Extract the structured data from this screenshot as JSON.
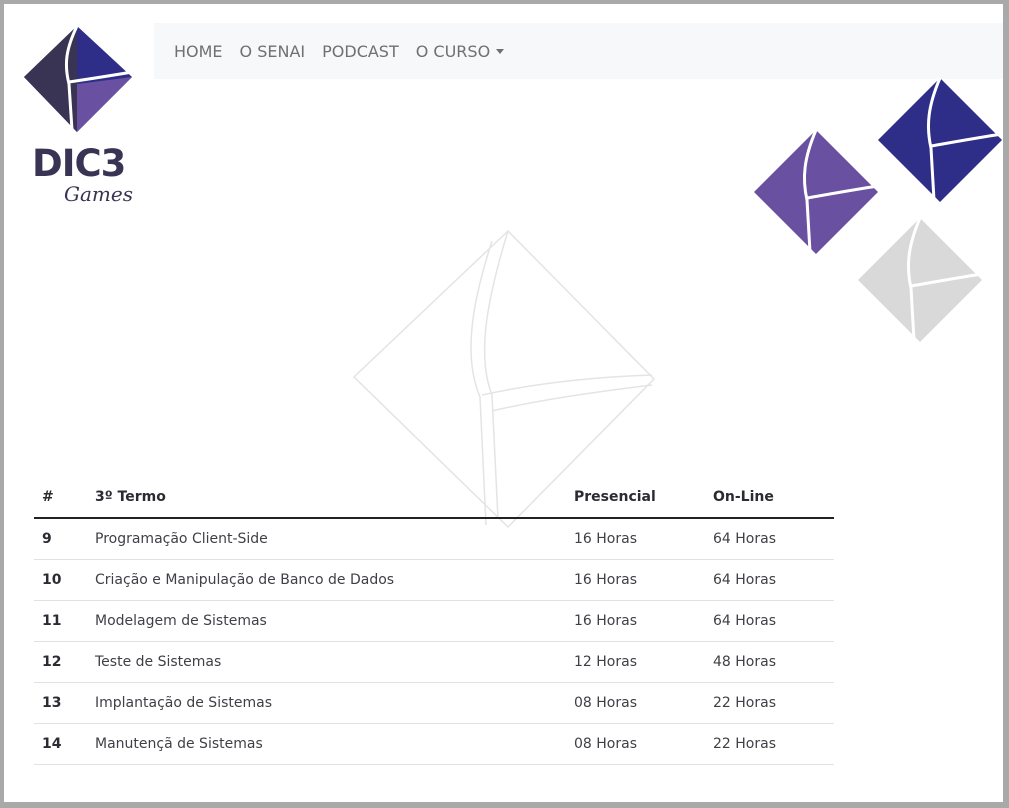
{
  "brand": {
    "name": "DIC3",
    "tagline": "Games",
    "colors": {
      "dark": "#3a3454",
      "blue": "#2e2d88",
      "purple": "#6a50a0",
      "gray": "#d9d9d9"
    }
  },
  "nav": {
    "items": [
      {
        "label": "HOME"
      },
      {
        "label": "O SENAI"
      },
      {
        "label": "PODCAST"
      },
      {
        "label": "O CURSO",
        "dropdown": true
      }
    ]
  },
  "table": {
    "headers": [
      "#",
      "3º Termo",
      "Presencial",
      "On-Line"
    ],
    "rows": [
      {
        "num": "9",
        "name": "Programação Client-Side",
        "presencial": "16 Horas",
        "online": "64 Horas"
      },
      {
        "num": "10",
        "name": "Criação e Manipulação de Banco de Dados",
        "presencial": "16 Horas",
        "online": "64 Horas"
      },
      {
        "num": "11",
        "name": "Modelagem de Sistemas",
        "presencial": "16 Horas",
        "online": "64 Horas"
      },
      {
        "num": "12",
        "name": "Teste de Sistemas",
        "presencial": "12 Horas",
        "online": "48 Horas"
      },
      {
        "num": "13",
        "name": "Implantação de Sistemas",
        "presencial": "08 Horas",
        "online": "22 Horas"
      },
      {
        "num": "14",
        "name": "Manutençã de Sistemas",
        "presencial": "08 Horas",
        "online": "22 Horas"
      }
    ]
  }
}
